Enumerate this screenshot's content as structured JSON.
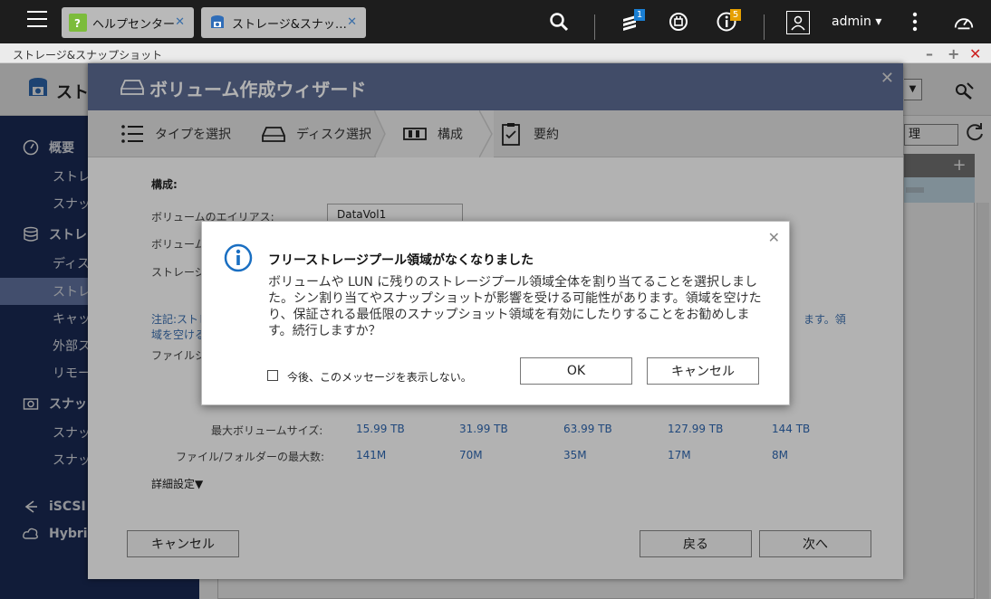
{
  "taskbar": {
    "tabs": [
      {
        "label": "ヘルプセンター",
        "icon": "help-icon"
      },
      {
        "label": "ストレージ&スナッ…",
        "icon": "storage-snapshot-icon"
      }
    ],
    "notifications": {
      "tasks_count": "1",
      "alerts_count": "5"
    },
    "user": "admin ▾"
  },
  "window": {
    "title": "ストレージ&スナップショット",
    "minimize": "–",
    "maximize": "+",
    "close": "✕"
  },
  "app": {
    "title": "スト",
    "manage_label": "理",
    "sidebar": [
      {
        "label": "概要",
        "type": "group"
      },
      {
        "label": "ストレ",
        "type": "sub"
      },
      {
        "label": "スナッ",
        "type": "sub"
      },
      {
        "label": "ストレ",
        "type": "group"
      },
      {
        "label": "ディス",
        "type": "sub"
      },
      {
        "label": "ストレ",
        "type": "sub",
        "active": true
      },
      {
        "label": "キャッ",
        "type": "sub"
      },
      {
        "label": "外部ス",
        "type": "sub"
      },
      {
        "label": "リモー",
        "type": "sub"
      },
      {
        "label": "スナッ",
        "type": "group"
      },
      {
        "label": "スナッ",
        "type": "sub"
      },
      {
        "label": "スナッ",
        "type": "sub"
      },
      {
        "label": "iSCSI &",
        "type": "group"
      },
      {
        "label": "Hybrid",
        "type": "group"
      }
    ]
  },
  "wizard": {
    "title": "ボリューム作成ウィザード",
    "close": "✕",
    "steps": [
      "タイプを選択",
      "ディスク選択",
      "構成",
      "要約"
    ],
    "section_title": "構成:",
    "alias_label": "ボリュームのエイリアス:",
    "alias_value": "DataVol1",
    "row2_label": "ボリューム",
    "row3_label": "ストレージ",
    "note_left_1": "注記:ストレ",
    "note_left_2": "域を空ける",
    "note_right": "ます。領",
    "row4_label": "ファイルシ",
    "max_size_label": "最大ボリュームサイズ:",
    "max_size_values": [
      "15.99 TB",
      "31.99 TB",
      "63.99 TB",
      "127.99 TB",
      "144 TB"
    ],
    "max_files_label": "ファイル/フォルダーの最大数:",
    "max_files_values": [
      "141M",
      "70M",
      "35M",
      "17M",
      "8M"
    ],
    "advanced": "詳細設定▼",
    "cancel": "キャンセル",
    "back": "戻る",
    "next": "次へ"
  },
  "dialog": {
    "title": "フリーストレージプール領域がなくなりました",
    "message": "ボリュームや LUN に残りのストレージプール領域全体を割り当てることを選択しました。シン割り当てやスナップショットが影響を受ける可能性があります。領域を空けたり、保証される最低限のスナップショット領域を有効にしたりすることをお勧めします。続行しますか？",
    "checkbox_label": "今後、このメッセージを表示しない。",
    "ok": "OK",
    "cancel": "キャンセル",
    "close": "✕"
  }
}
